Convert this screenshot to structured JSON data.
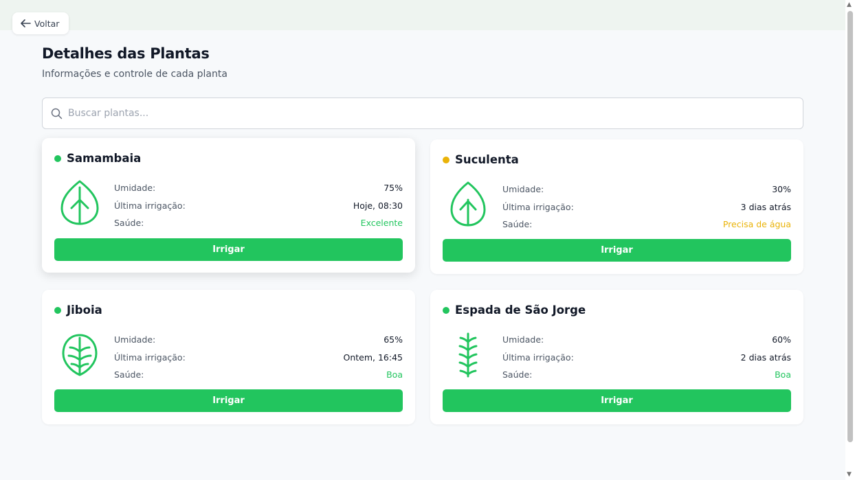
{
  "header": {
    "back_label": "Voltar",
    "title": "Detalhes das Plantas",
    "subtitle": "Informações e controle de cada planta"
  },
  "search": {
    "placeholder": "Buscar plantas...",
    "value": ""
  },
  "labels": {
    "humidity": "Umidade:",
    "last_irrigation": "Última irrigação:",
    "health": "Saúde:",
    "irrigate_button": "Irrigar"
  },
  "colors": {
    "accent_green": "#22c55e",
    "warning_yellow": "#eab308"
  },
  "plants": [
    {
      "name": "Samambaia",
      "status_color": "#22c55e",
      "icon": "leaf-icon",
      "humidity": "75%",
      "last_irrigation": "Hoje, 08:30",
      "health": "Excelente",
      "health_color": "#22c55e"
    },
    {
      "name": "Suculenta",
      "status_color": "#eab308",
      "icon": "leaf-icon",
      "humidity": "30%",
      "last_irrigation": "3 dias atrás",
      "health": "Precisa de água",
      "health_color": "#eab308"
    },
    {
      "name": "Jiboia",
      "status_color": "#22c55e",
      "icon": "round-leaf-icon",
      "humidity": "65%",
      "last_irrigation": "Ontem, 16:45",
      "health": "Boa",
      "health_color": "#22c55e"
    },
    {
      "name": "Espada de São Jorge",
      "status_color": "#22c55e",
      "icon": "fern-stem-icon",
      "humidity": "60%",
      "last_irrigation": "2 dias atrás",
      "health": "Boa",
      "health_color": "#22c55e"
    }
  ]
}
